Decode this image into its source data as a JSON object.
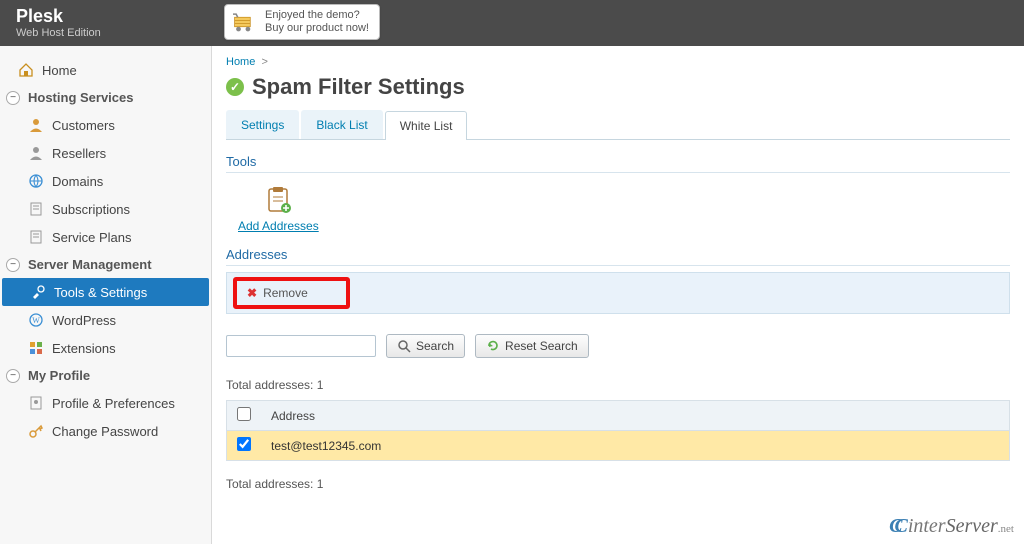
{
  "brand": {
    "name": "Plesk",
    "subtitle": "Web Host Edition"
  },
  "promo": {
    "line1": "Enjoyed the demo?",
    "line2": "Buy our product now!"
  },
  "sidebar": {
    "home": "Home",
    "groups": [
      {
        "label": "Hosting Services",
        "items": [
          {
            "label": "Customers",
            "icon": "user"
          },
          {
            "label": "Resellers",
            "icon": "user"
          },
          {
            "label": "Domains",
            "icon": "globe"
          },
          {
            "label": "Subscriptions",
            "icon": "doc"
          },
          {
            "label": "Service Plans",
            "icon": "doc"
          }
        ]
      },
      {
        "label": "Server Management",
        "items": [
          {
            "label": "Tools & Settings",
            "icon": "tools",
            "active": true
          },
          {
            "label": "WordPress",
            "icon": "wp"
          },
          {
            "label": "Extensions",
            "icon": "ext"
          }
        ]
      },
      {
        "label": "My Profile",
        "items": [
          {
            "label": "Profile & Preferences",
            "icon": "profile"
          },
          {
            "label": "Change Password",
            "icon": "key"
          }
        ]
      }
    ]
  },
  "breadcrumb": {
    "home": "Home"
  },
  "page": {
    "title": "Spam Filter Settings"
  },
  "tabs": [
    {
      "label": "Settings",
      "active": false
    },
    {
      "label": "Black List",
      "active": false
    },
    {
      "label": "White List",
      "active": true
    }
  ],
  "sections": {
    "tools": "Tools",
    "addresses": "Addresses"
  },
  "tools": {
    "add_addresses": "Add Addresses"
  },
  "toolbar": {
    "remove": "Remove"
  },
  "search": {
    "placeholder": "",
    "search_btn": "Search",
    "reset_btn": "Reset Search"
  },
  "table": {
    "total_prefix": "Total addresses: ",
    "total": "1",
    "col_address": "Address",
    "rows": [
      {
        "address": "test@test12345.com",
        "checked": true
      }
    ]
  },
  "footer": {
    "brand_cc": "C",
    "brand_c2": "C",
    "brand_inter": "inter",
    "brand_server": "Server",
    "brand_net": ".net"
  }
}
